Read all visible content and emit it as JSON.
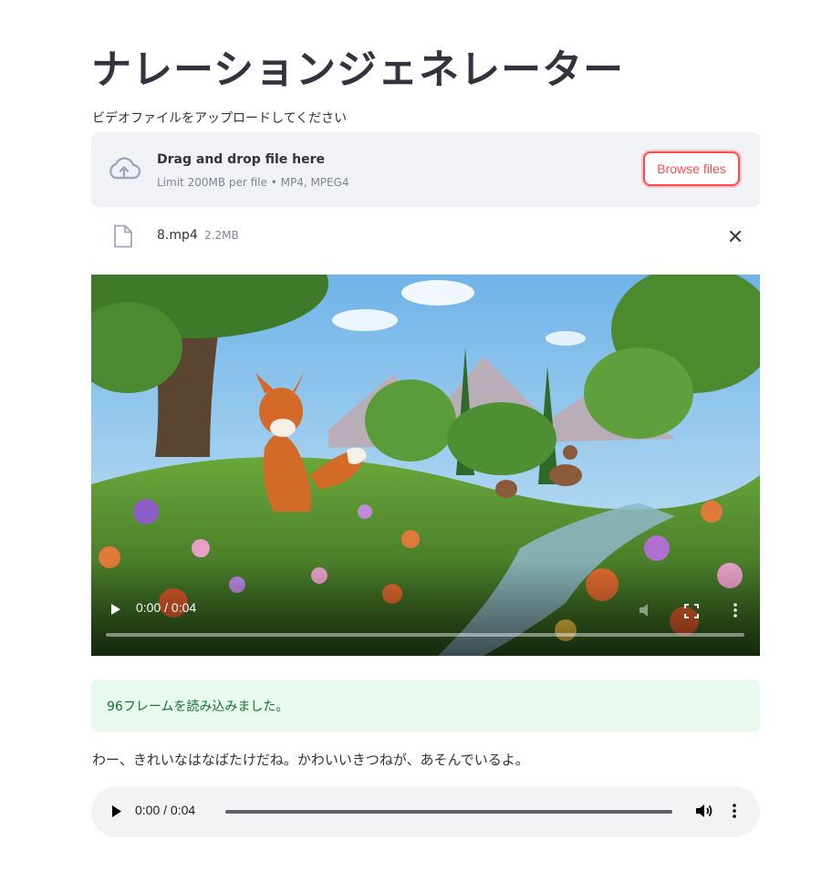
{
  "page": {
    "title": "ナレーションジェネレーター",
    "upload_label": "ビデオファイルをアップロードしてください"
  },
  "uploader": {
    "primary_text": "Drag and drop file here",
    "secondary_text": "Limit 200MB per file • MP4, MPEG4",
    "browse_label": "Browse files",
    "icon": "cloud-upload-icon"
  },
  "file": {
    "name": "8.mp4",
    "size": "2.2MB",
    "icon": "file-icon"
  },
  "video": {
    "time": "0:00 / 0:04",
    "progress": 0
  },
  "status": {
    "message": "96フレームを読み込みました。"
  },
  "narration": {
    "text": "わー、きれいなはなばたけだね。かわいいきつねが、あそんでいるよ。"
  },
  "audio": {
    "time": "0:00 / 0:04",
    "progress": 0
  },
  "colors": {
    "accent": "#ff4b4b",
    "dropzone_bg": "#f0f2f6",
    "success_bg": "#e8f9ee",
    "success_text": "#177233",
    "audio_bg": "#f1f3f4"
  }
}
